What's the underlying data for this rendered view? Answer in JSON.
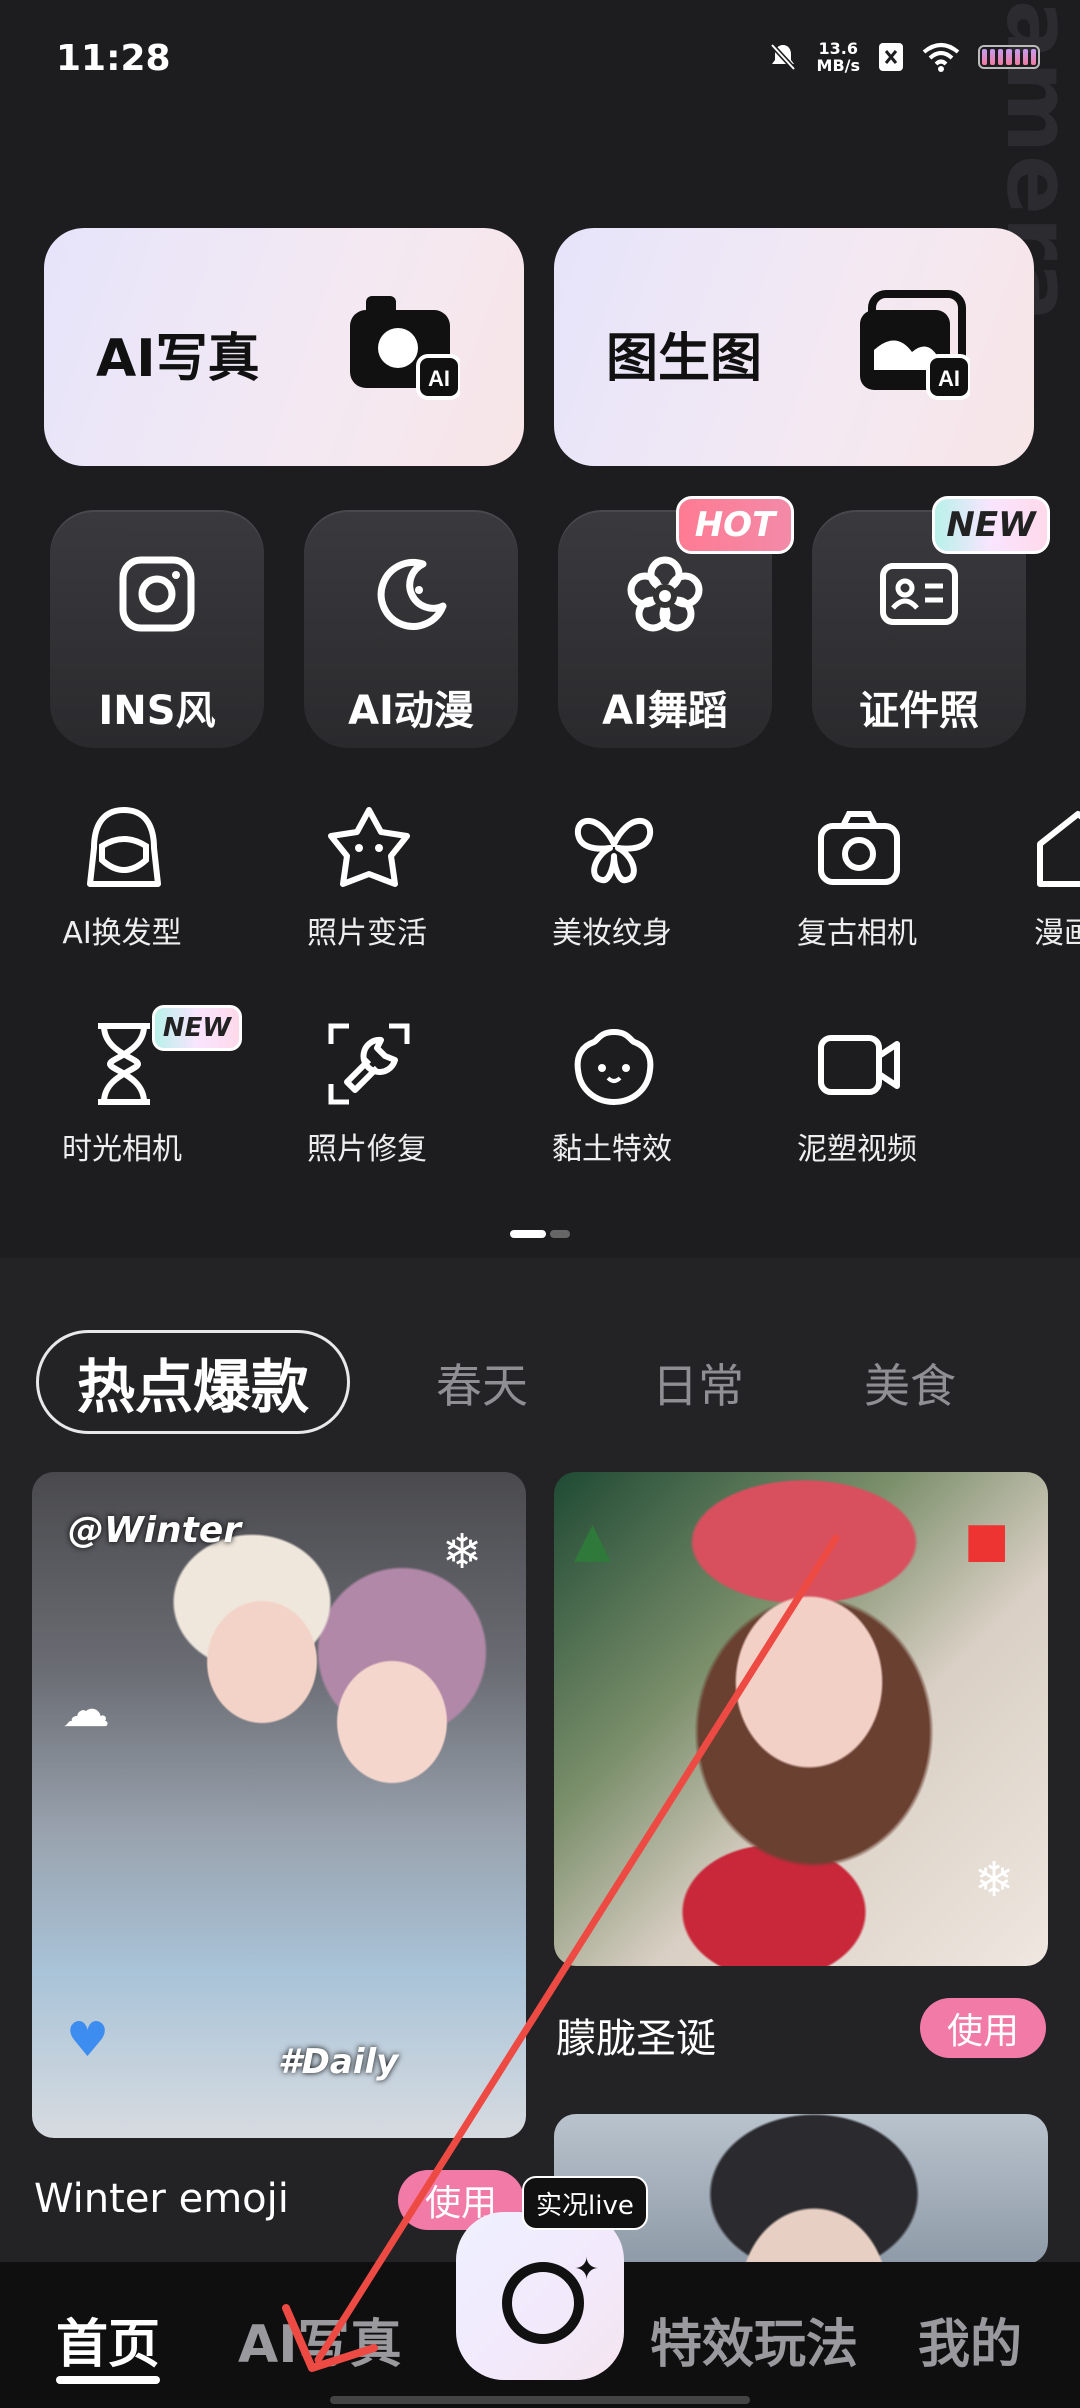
{
  "status_bar": {
    "time": "11:28",
    "net_speed_value": "13.6",
    "net_speed_unit": "MB/s"
  },
  "hero_cards": [
    {
      "label": "AI写真",
      "icon": "camera-ai-icon",
      "icon_text": "AI"
    },
    {
      "label": "图生图",
      "icon": "image-ai-icon",
      "icon_text": "AI"
    }
  ],
  "quick_tiles": [
    {
      "label": "INS风",
      "icon": "instagram-icon"
    },
    {
      "label": "AI动漫",
      "icon": "moon-icon"
    },
    {
      "label": "AI舞蹈",
      "icon": "flower-icon",
      "badge": "HOT"
    },
    {
      "label": "证件照",
      "icon": "id-card-icon",
      "badge": "NEW"
    }
  ],
  "features_row1": [
    "AI换发型",
    "照片变活",
    "美妆纹身",
    "复古相机",
    "漫画"
  ],
  "features_row2": [
    "时光相机",
    "照片修复",
    "黏土特效",
    "泥塑视频"
  ],
  "feature_new_badge": "NEW",
  "categories": {
    "active": "热点爆款",
    "items": [
      "春天",
      "日常",
      "美食"
    ]
  },
  "feed": [
    {
      "title": "Winter emoji",
      "button": "使用",
      "overlay_top": "@Winter",
      "overlay_bottom": "#Daily"
    },
    {
      "title": "朦胧圣诞",
      "button": "使用"
    }
  ],
  "live_badge": "实况live",
  "nav": {
    "home": "首页",
    "ai_photo": "AI写真",
    "effects": "特效玩法",
    "mine": "我的"
  },
  "colors": {
    "accent_pink": "#f27aa6",
    "background": "#1e1e20"
  }
}
